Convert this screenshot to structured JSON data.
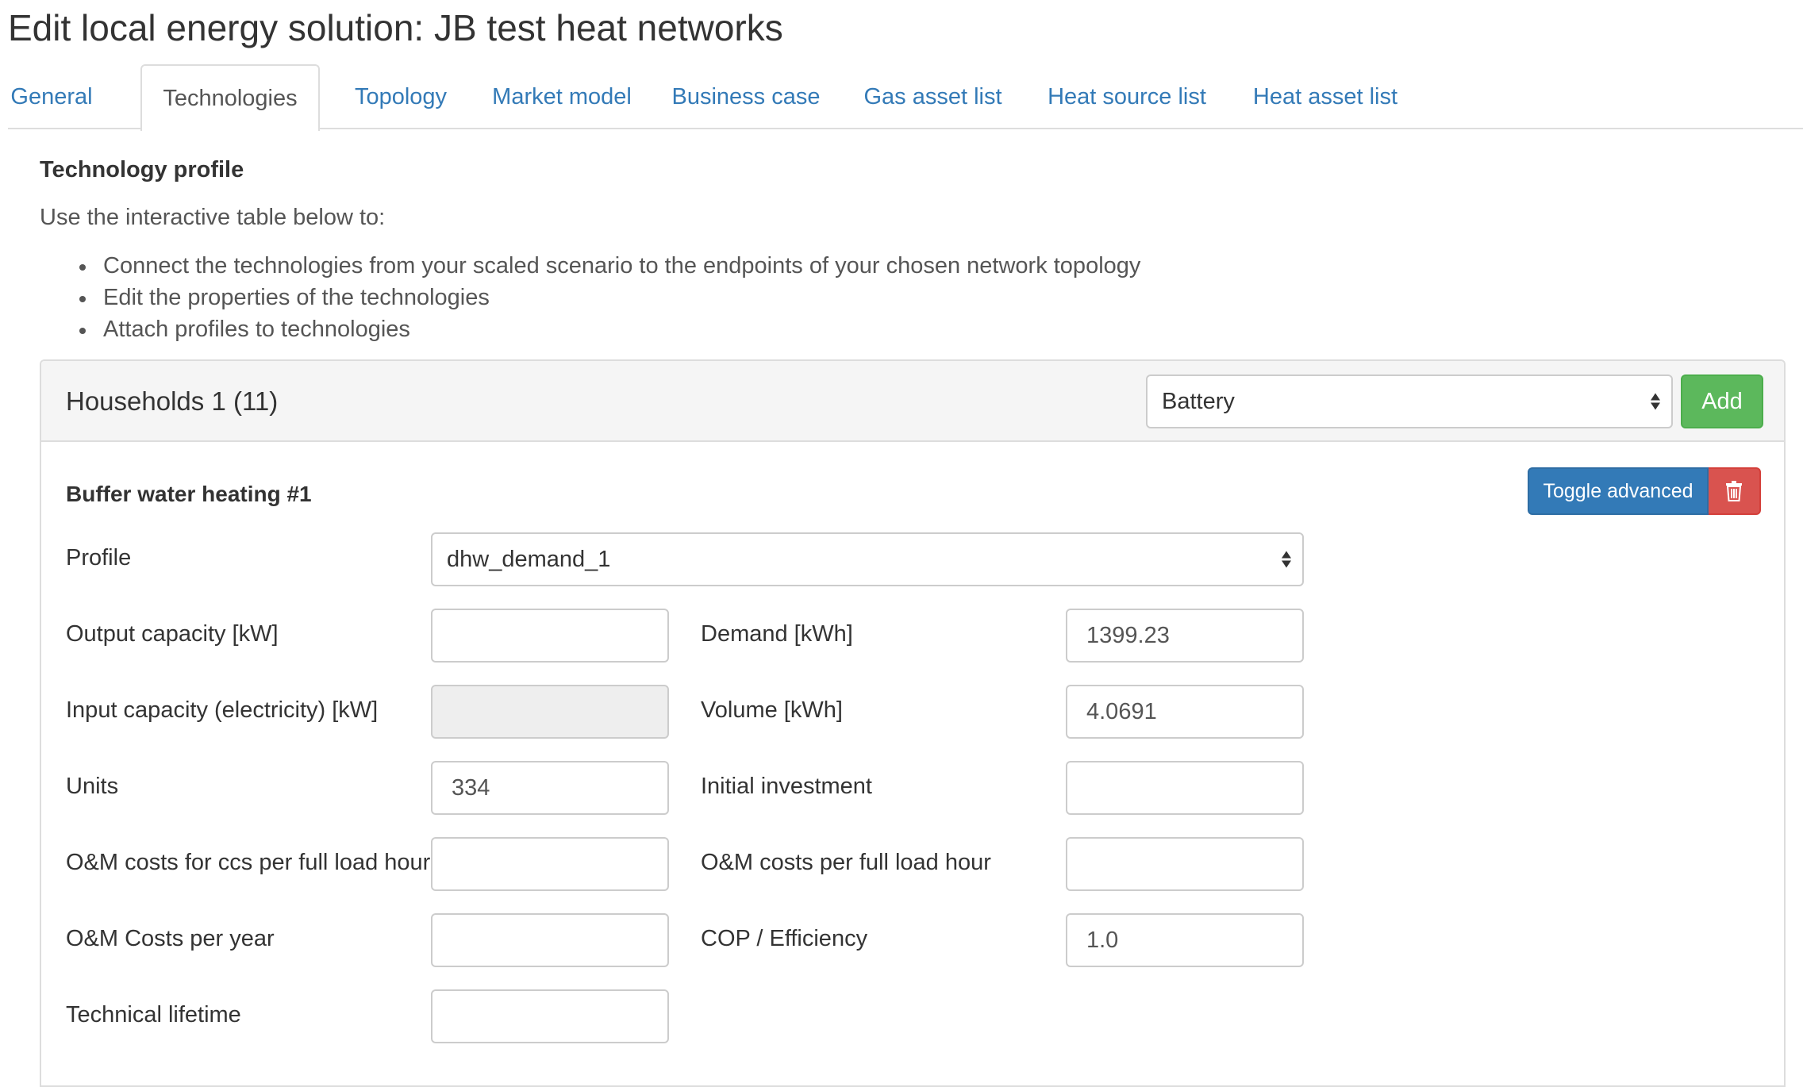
{
  "page": {
    "title": "Edit local energy solution: JB test heat networks"
  },
  "tabs": [
    {
      "label": "General",
      "active": false
    },
    {
      "label": "Technologies",
      "active": true
    },
    {
      "label": "Topology",
      "active": false
    },
    {
      "label": "Market model",
      "active": false
    },
    {
      "label": "Business case",
      "active": false
    },
    {
      "label": "Gas asset list",
      "active": false
    },
    {
      "label": "Heat source list",
      "active": false
    },
    {
      "label": "Heat asset list",
      "active": false
    }
  ],
  "intro": {
    "heading": "Technology profile",
    "text": "Use the interactive table below to:",
    "bullets": [
      "Connect the technologies from your scaled scenario to the endpoints of your chosen network topology",
      "Edit the properties of the technologies",
      "Attach profiles to technologies"
    ]
  },
  "panel": {
    "title": "Households 1 (11)",
    "technology_select": {
      "selected": "Battery"
    },
    "add_label": "Add",
    "colors": {
      "add": "#5cb85c",
      "toggle": "#337ab7",
      "delete": "#d9534f"
    }
  },
  "technology": {
    "title": "Buffer water heating #1",
    "toggle_label": "Toggle advanced",
    "delete_icon": "trash-icon",
    "profile": {
      "label": "Profile",
      "selected": "dhw_demand_1"
    },
    "fields_left": [
      {
        "label": "Output capacity [kW]",
        "value": "",
        "disabled": false
      },
      {
        "label": "Input capacity (electricity) [kW]",
        "value": "",
        "disabled": true
      },
      {
        "label": "Units",
        "value": "334",
        "disabled": false
      },
      {
        "label": "O&M costs for ccs per full load hour",
        "value": "",
        "disabled": false
      },
      {
        "label": "O&M Costs per year",
        "value": "",
        "disabled": false
      },
      {
        "label": "Technical lifetime",
        "value": "",
        "disabled": false
      }
    ],
    "fields_right": [
      {
        "label": "Demand [kWh]",
        "value": "1399.23"
      },
      {
        "label": "Volume [kWh]",
        "value": "4.0691"
      },
      {
        "label": "Initial investment",
        "value": ""
      },
      {
        "label": "O&M costs per full load hour",
        "value": ""
      },
      {
        "label": "COP / Efficiency",
        "value": "1.0"
      }
    ]
  }
}
